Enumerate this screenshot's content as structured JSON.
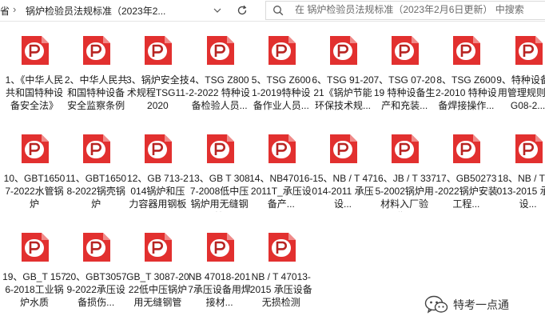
{
  "address": {
    "prev_crumb": "省",
    "current": "锅炉检验员法规标准（2023年2..."
  },
  "search": {
    "placeholder": "在 锅炉检验员法规标准（2023年2月6日更新） 中搜索"
  },
  "files": [
    {
      "label": "1、《中华人民共和国特种设备安全法》"
    },
    {
      "label": "2、中华人民共和国特种设备安全监察条例"
    },
    {
      "label": "3、锅炉安全技术规程TSG11-2020"
    },
    {
      "label": "4、TSG Z8002-2022 特种设备检验人员..."
    },
    {
      "label": "5、TSG Z6001-2019特种设备作业人员..."
    },
    {
      "label": "6、TSG 91-2021《锅炉节能环保技术规..."
    },
    {
      "label": "7、TSG 07-2019 特种设备生产和充装..."
    },
    {
      "label": "8、TSG Z6002-2010 特种设备焊接操作..."
    },
    {
      "label": "9、特种设备使用管理规则TSG08-2..."
    },
    {
      "label": "10、GBT16507-2022水管锅炉"
    },
    {
      "label": "11、GBT16508-2022锅壳锅炉"
    },
    {
      "label": "12、GB 713-2014锅炉和压力容器用钢板"
    },
    {
      "label": "13、GB T 3087-2008低中压锅炉用无缝钢管"
    },
    {
      "label": "14、NB47016-2011T_承压设备产..."
    },
    {
      "label": "15、NB / T 47014-2011 承压设..."
    },
    {
      "label": "16、JB / T 3375-2002锅炉用材料入厂验收..."
    },
    {
      "label": "17、GB50273-2022锅炉安装工程..."
    },
    {
      "label": "18、NB / T 47013-2015 承压设..."
    },
    {
      "label": "19、GB_T 1576-2018工业锅炉水质"
    },
    {
      "label": "20、GBT30579-2022承压设备损伤..."
    },
    {
      "label": "GB_T 3087-2022低中压锅炉用无缝钢管"
    },
    {
      "label": "NB 47018-2017承压设备用焊接材..."
    },
    {
      "label": "NB / T 47013-2015 承压设备无损检测"
    }
  ],
  "watermark": {
    "text": "特考一点通"
  },
  "colors": {
    "pdf_red": "#e2302f",
    "pdf_red_dark": "#b82422",
    "pdf_fold": "#f08b8a"
  }
}
